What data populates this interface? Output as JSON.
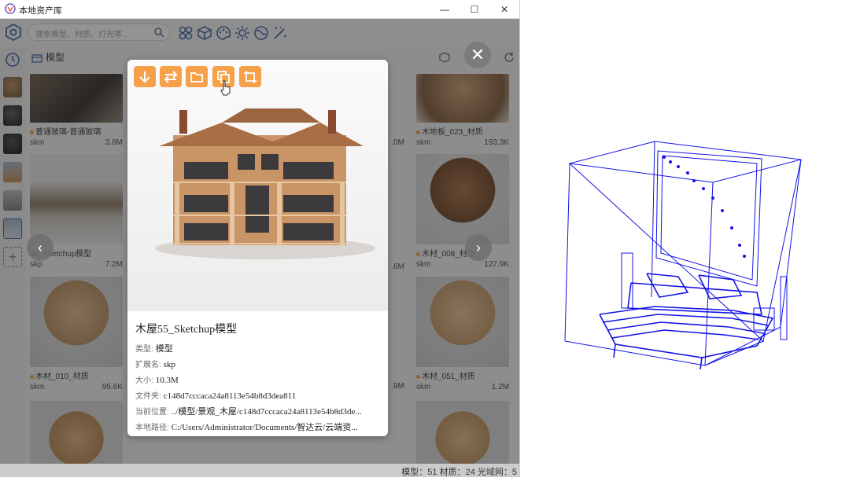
{
  "window": {
    "title": "本地资产库",
    "minimize": "—",
    "maximize": "☐",
    "close": "✕"
  },
  "toolbar": {
    "search_placeholder": "搜索模型、材质、灯光等..."
  },
  "crumb": {
    "label": "模型"
  },
  "grid": {
    "row1": [
      {
        "name": "普通玻璃-普通玻璃",
        "format": "skm",
        "size": "3.8M"
      },
      {
        "name": "",
        "format": "",
        "size": ""
      },
      {
        "name": "",
        "format": "",
        "size": ""
      },
      {
        "name": "_",
        "format": "",
        "size": ".0M"
      },
      {
        "name": "木地板_023_材质",
        "format": "skm",
        "size": "193.3K"
      }
    ],
    "row2": [
      {
        "name": "40_Sketchup模型",
        "format": "skp",
        "size": "7.2M"
      },
      {
        "name": "",
        "format": "",
        "size": ""
      },
      {
        "name": "",
        "format": "",
        "size": ""
      },
      {
        "name": "",
        "format": "",
        "size": ".6M"
      },
      {
        "name": "木材_008_材质",
        "format": "skm",
        "size": "127.9K"
      }
    ],
    "row3": [
      {
        "name": "木材_010_材质",
        "format": "skm",
        "size": "95.6K"
      },
      {
        "name": "",
        "format": "",
        "size": ""
      },
      {
        "name": "",
        "format": "",
        "size": ""
      },
      {
        "name": "",
        "format": "",
        "size": ".9M"
      },
      {
        "name": "木材_051_材质",
        "format": "skm",
        "size": "1.2M"
      }
    ]
  },
  "status": {
    "text": "模型：51 材质：24 光域网：5"
  },
  "detail": {
    "title": "木屋55_Sketchup模型",
    "type_label": "类型:",
    "type": "模型",
    "ext_label": "扩展名:",
    "ext": "skp",
    "size_label": "大小:",
    "size": "10.3M",
    "folder_label": "文件夹:",
    "folder": "c148d7cccaca24a8113e54b8d3dea811",
    "location_label": "当前位置:",
    "location": "../模型/景观_木屋/c148d7cccaca24a8113e54b8d3de...",
    "path_label": "本地路径:",
    "path": "C:/Users/Administrator/Documents/智达云/云端资..."
  },
  "nav": {
    "prev": "‹",
    "next": "›",
    "close": "✕"
  },
  "colors": {
    "accent": "#f6a04a",
    "wireframe": "#1414e6",
    "sidebar_icon": "#3a5fa0"
  }
}
